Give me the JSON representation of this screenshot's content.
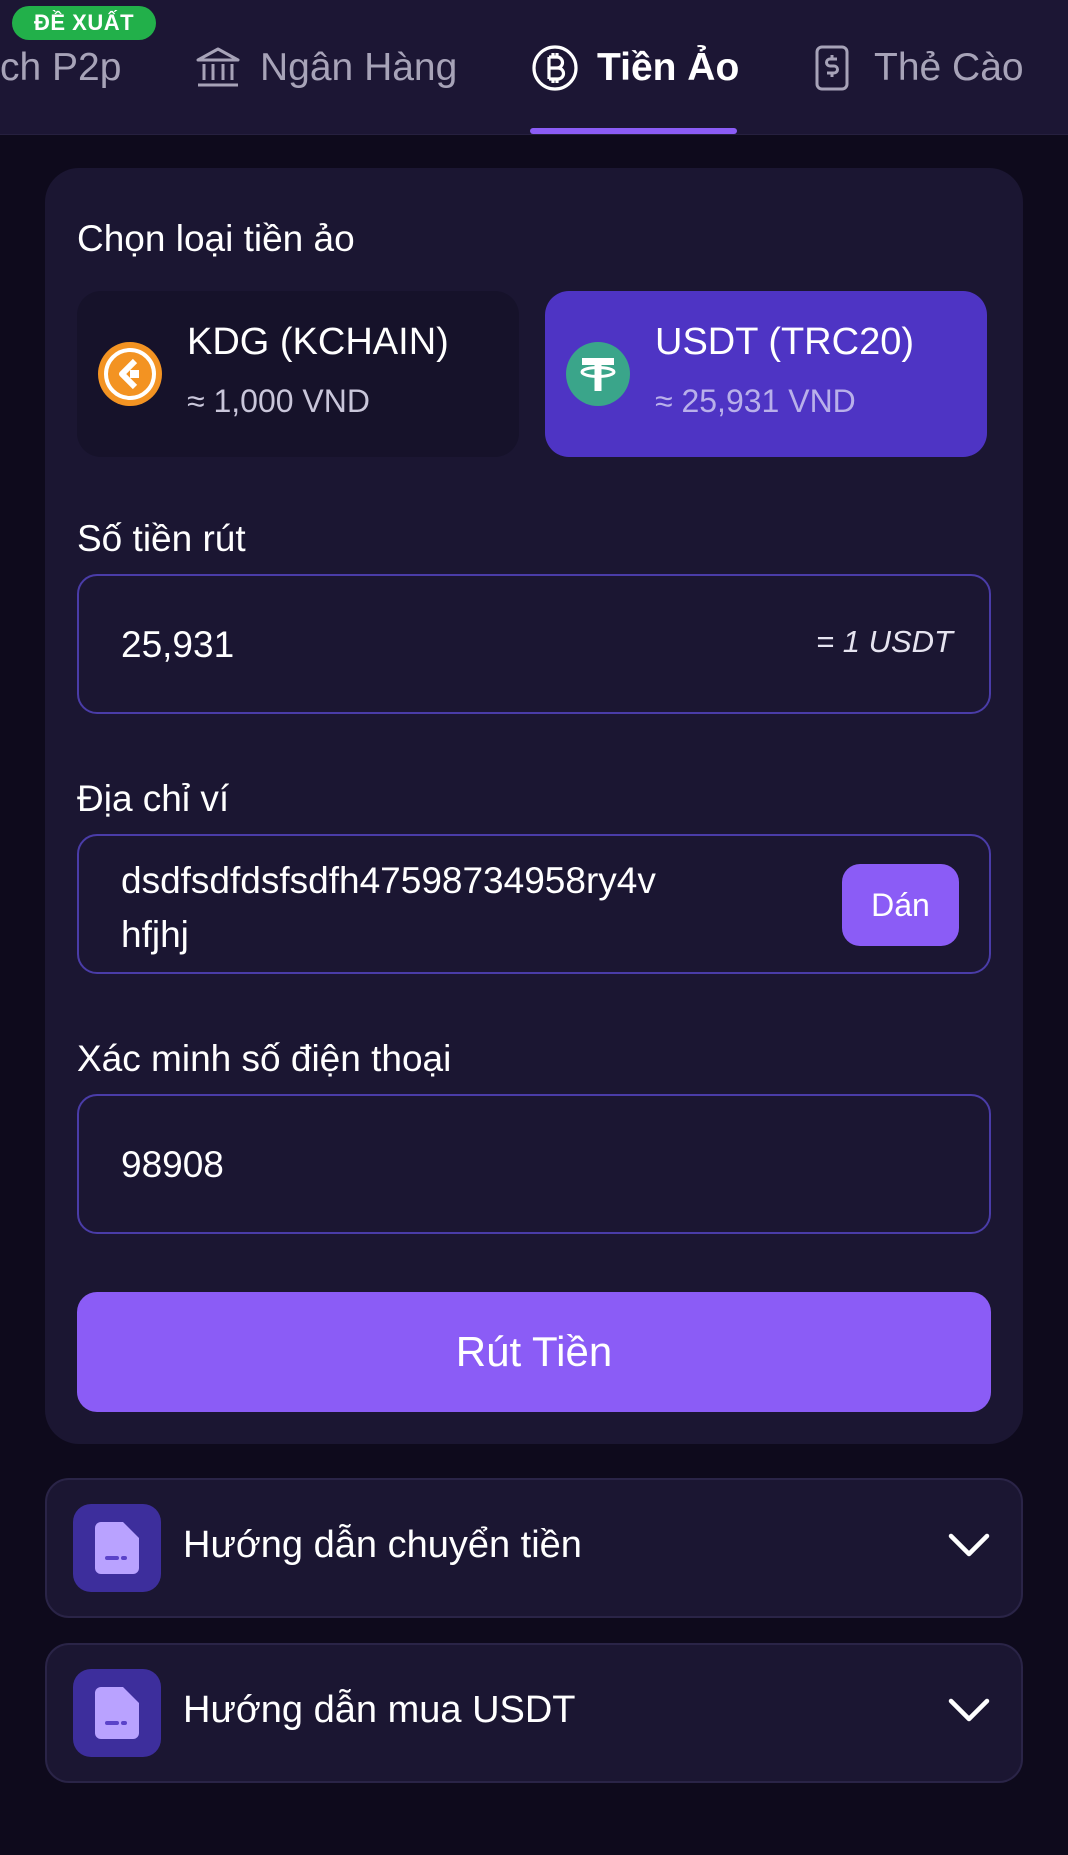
{
  "tabs": {
    "badge": "ĐỀ XUẤT",
    "items": [
      {
        "label": "ch P2p",
        "icon": "none",
        "active": false
      },
      {
        "label": "Ngân Hàng",
        "icon": "bank-icon",
        "active": false
      },
      {
        "label": "Tiền Ảo",
        "icon": "bitcoin-icon",
        "active": true
      },
      {
        "label": "Thẻ Cào",
        "icon": "phone-card-icon",
        "active": false
      }
    ]
  },
  "form": {
    "coin_section_label": "Chọn loại tiền ảo",
    "coins": [
      {
        "name": "KDG (KCHAIN)",
        "rate": "≈ 1,000 VND",
        "icon": "kdg-logo",
        "selected": false
      },
      {
        "name": "USDT (TRC20)",
        "rate": "≈ 25,931 VND",
        "icon": "tether-logo",
        "selected": true
      }
    ],
    "amount_label": "Số tiền rút",
    "amount_value": "25,931",
    "amount_conversion": "= 1 USDT",
    "wallet_label": "Địa chỉ ví",
    "wallet_value_line1": "dsdfsdfdsfsdfh47598734958ry4v",
    "wallet_value_line2": "hfjhj",
    "paste_label": "Dán",
    "phone_label": "Xác minh số điện thoại",
    "phone_value": "98908",
    "submit_label": "Rút Tiền"
  },
  "guides": [
    {
      "title": "Hướng dẫn chuyển tiền",
      "icon": "document-icon"
    },
    {
      "title": "Hướng dẫn mua USDT",
      "icon": "document-icon"
    }
  ],
  "colors": {
    "accent": "#8b5cf6",
    "selected_card": "#4e34c4",
    "badge": "#22b04a",
    "background": "#0e0a1c",
    "card": "#1b1632"
  }
}
